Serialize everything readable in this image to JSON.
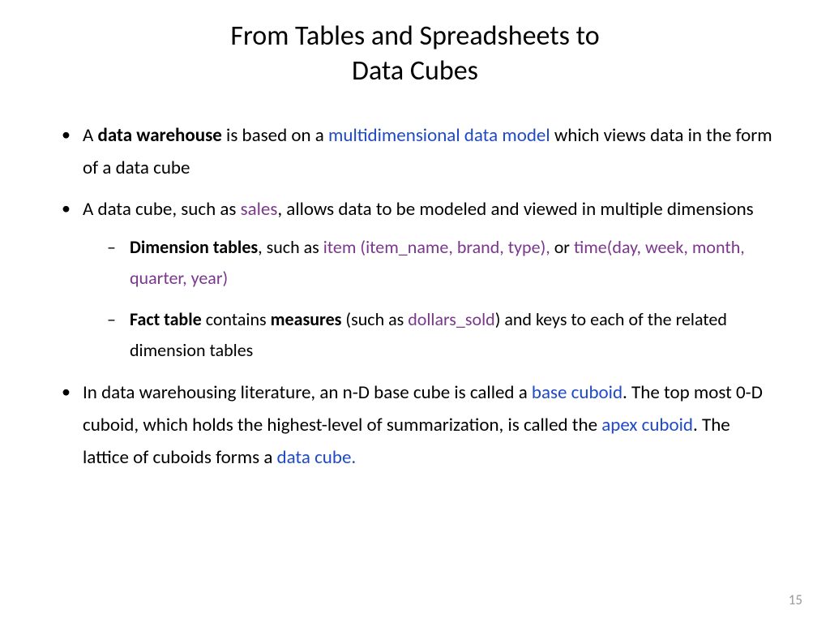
{
  "title_line1": "From Tables and Spreadsheets to",
  "title_line2": "Data Cubes",
  "b1_p1": "A ",
  "b1_bold": "data warehouse",
  "b1_p2": " is based on a ",
  "b1_blue": "multidimensional data model",
  "b1_p3": " which views data in the form of a data cube",
  "b2_p1": "A data cube, such as ",
  "b2_purple": "sales",
  "b2_p2": ", allows data to be modeled and viewed in multiple dimensions",
  "b2s1_bold": "Dimension tables",
  "b2s1_p1": ", such as ",
  "b2s1_purple1": "item (item_name, brand, type),",
  "b2s1_p2": " or ",
  "b2s1_purple2": "time(day, week, month, quarter, year)",
  "b2s2_bold1": "Fact table",
  "b2s2_p1": " contains ",
  "b2s2_bold2": "measures",
  "b2s2_p2": " (such as ",
  "b2s2_purple": "dollars_sold",
  "b2s2_p3": ") and keys to each of the related dimension tables",
  "b3_p1": "In data warehousing literature, an n-D base cube is called a ",
  "b3_blue1": "base cuboid",
  "b3_p2": ". The top most 0-D cuboid, which holds the highest-level of summarization, is called the ",
  "b3_blue2": "apex cuboid",
  "b3_p3": ".  The lattice of cuboids forms a ",
  "b3_blue3": "data cube.",
  "page_number": "15"
}
